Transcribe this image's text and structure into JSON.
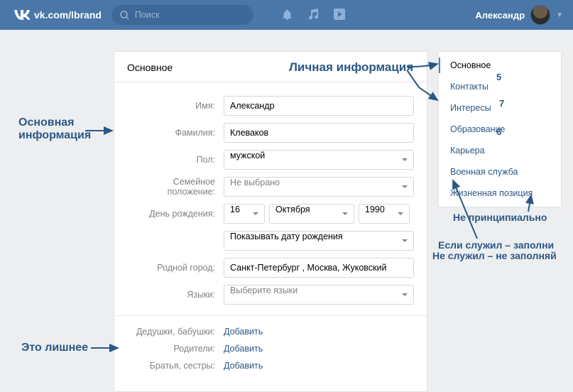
{
  "header": {
    "url": "vk.com/lbrand",
    "search_placeholder": "Поиск",
    "username": "Александр"
  },
  "card": {
    "title": "Основное"
  },
  "labels": {
    "name": "Имя:",
    "surname": "Фамилия:",
    "gender": "Пол:",
    "marital": "Семейное положение:",
    "birthday": "День рождения:",
    "hometown": "Родной город:",
    "languages": "Языки:",
    "grandparents": "Дедушки, бабушки:",
    "parents": "Родители:",
    "siblings": "Братья, сестры:"
  },
  "values": {
    "name": "Александр",
    "surname": "Клеваков",
    "gender": "мужской",
    "marital": "Не выбрано",
    "bday_day": "16",
    "bday_month": "Октября",
    "bday_year": "1990",
    "bday_show": "Показывать дату рождения",
    "hometown": "Санкт-Петербург , Москва, Жуковский",
    "languages": "Выберите языки"
  },
  "add": "Добавить",
  "sidebar": [
    "Основное",
    "Контакты",
    "Интересы",
    "Образование",
    "Карьера",
    "Военная служба",
    "Жизненная позиция"
  ],
  "annotations": {
    "top_right": "Личная информация",
    "left_main": "Основная информация",
    "military1": "Если служил – заполни",
    "military2": "Не служил – не заполняй",
    "notimportant": "Не принципиально",
    "extra": "Это лишнее",
    "n5": "5",
    "n6": "6",
    "n7": "7"
  }
}
